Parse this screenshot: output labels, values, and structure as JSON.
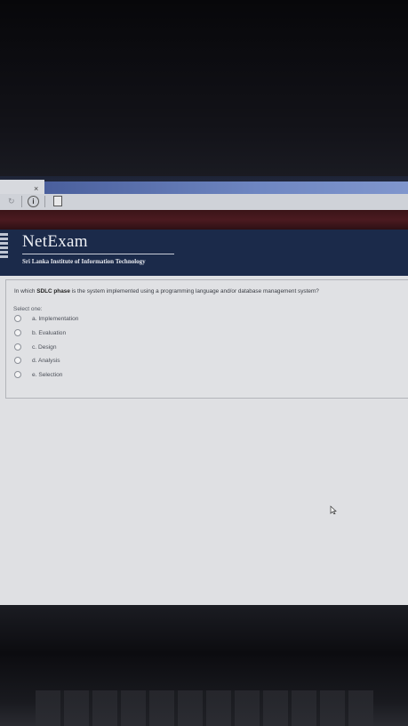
{
  "browser": {
    "tab_close_glyph": "×",
    "reload_glyph": "↻",
    "info_glyph": "i"
  },
  "header": {
    "title": "NetExam",
    "subtitle": "Sri Lanka Institute of Information Technology"
  },
  "question": {
    "prefix": "In which ",
    "highlight": "SDLC phase",
    "suffix": " is the system implemented using a programming language and/or database management system?",
    "prompt": "Select one:",
    "options": [
      {
        "label": "a. Implementation"
      },
      {
        "label": "b. Evaluation"
      },
      {
        "label": "c. Design"
      },
      {
        "label": "d. Analysis"
      },
      {
        "label": "e. Selection"
      }
    ]
  },
  "colors": {
    "header_bg": "#1b2a4a",
    "maroon_bar": "#4b1a20",
    "tab_blue": "#6f87c2"
  },
  "icons": [
    "close-icon",
    "reload-icon",
    "info-icon",
    "document-icon",
    "logo-icon",
    "mouse-cursor-icon"
  ]
}
